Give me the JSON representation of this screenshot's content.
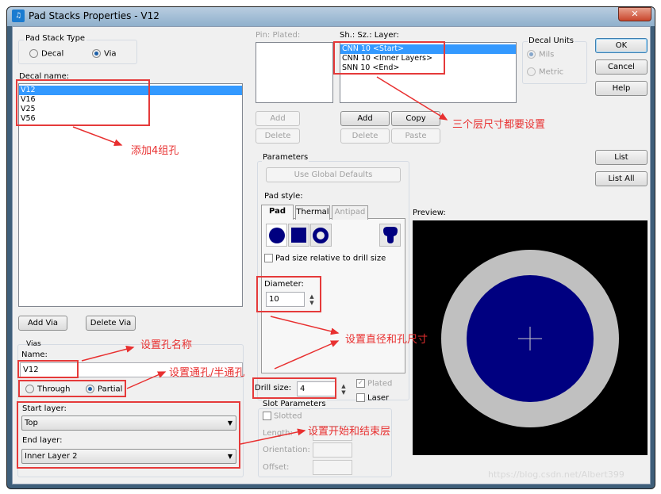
{
  "window": {
    "title": "Pad Stacks Properties - V12",
    "close_icon": "close-icon"
  },
  "pad_stack_type": {
    "label": "Pad Stack Type",
    "options": [
      {
        "label": "Decal",
        "selected": false
      },
      {
        "label": "Via",
        "selected": true
      }
    ]
  },
  "decal_name": {
    "label": "Decal name:",
    "items": [
      "V12",
      "V16",
      "V25",
      "V56"
    ],
    "selected": "V12"
  },
  "via_buttons": {
    "add": "Add Via",
    "delete": "Delete Via"
  },
  "vias": {
    "group_label": "Vias",
    "name_label": "Name:",
    "name_value": "V12",
    "through_label": "Through",
    "partial_label": "Partial",
    "selected_type": "Partial",
    "start_layer_label": "Start layer:",
    "start_layer_value": "Top",
    "end_layer_label": "End layer:",
    "end_layer_value": "Inner Layer 2"
  },
  "pins": {
    "header": "Pin:  Plated:",
    "add": "Add",
    "delete": "Delete"
  },
  "layers": {
    "header": "Sh.:  Sz.:  Layer:",
    "items": [
      "CNN 10 <Start>",
      "CNN 10 <Inner Layers>",
      "SNN 10 <End>"
    ],
    "selected": "CNN 10 <Start>",
    "add": "Add",
    "copy": "Copy",
    "delete": "Delete",
    "paste": "Paste"
  },
  "decal_units": {
    "label": "Decal Units",
    "mils": "Mils",
    "metric": "Metric"
  },
  "dialog_buttons": {
    "ok": "OK",
    "cancel": "Cancel",
    "help": "Help",
    "list": "List",
    "list_all": "List All"
  },
  "parameters": {
    "label": "Parameters",
    "use_global_defaults": "Use Global Defaults",
    "pad_style_label": "Pad style:",
    "tabs": [
      "Pad",
      "Thermal",
      "Antipad"
    ],
    "active_tab": "Pad",
    "shapes": [
      "round-pad-icon",
      "square-pad-icon",
      "annular-pad-icon",
      "custom-pad-icon"
    ],
    "relative_checkbox": "Pad size relative to drill size",
    "diameter_label": "Diameter:",
    "diameter_value": "10"
  },
  "drill": {
    "label": "Drill size:",
    "value": "4",
    "plated": "Plated",
    "plated_checked": true,
    "laser": "Laser",
    "laser_checked": false
  },
  "slot": {
    "label": "Slot Parameters",
    "slotted": "Slotted",
    "length": "Length:",
    "orientation": "Orientation:",
    "offset": "Offset:"
  },
  "preview": {
    "label": "Preview:",
    "colors": {
      "background": "#000000",
      "ring": "#c0c0c0",
      "pad": "#000080"
    }
  },
  "annotations": {
    "add_four": "添加4组孔",
    "three_layers": "三个层尺寸都要设置",
    "hole_name": "设置孔名称",
    "through_partial": "设置通孔/半通孔",
    "diameter_hole": "设置直径和孔尺寸",
    "start_end": "设置开始和结束层"
  },
  "watermark": "https://blog.csdn.net/Albert399"
}
